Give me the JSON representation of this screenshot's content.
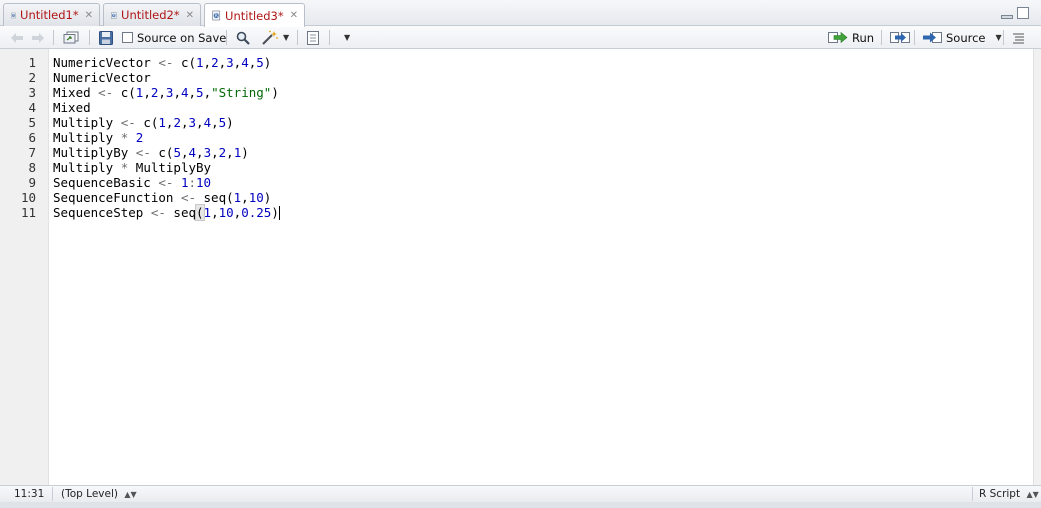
{
  "tabs": [
    {
      "label": "Untitled1*",
      "active": false
    },
    {
      "label": "Untitled2*",
      "active": false
    },
    {
      "label": "Untitled3*",
      "active": true
    }
  ],
  "toolbar": {
    "source_on_save_label": "Source on Save",
    "run_label": "Run",
    "source_label": "Source"
  },
  "editor": {
    "lines": [
      {
        "n": "1",
        "tokens": [
          [
            "id",
            "NumericVector "
          ],
          [
            "op",
            "<-"
          ],
          [
            "id",
            " c("
          ],
          [
            "num",
            "1"
          ],
          [
            "id",
            ","
          ],
          [
            "num",
            "2"
          ],
          [
            "id",
            ","
          ],
          [
            "num",
            "3"
          ],
          [
            "id",
            ","
          ],
          [
            "num",
            "4"
          ],
          [
            "id",
            ","
          ],
          [
            "num",
            "5"
          ],
          [
            "id",
            ")"
          ]
        ]
      },
      {
        "n": "2",
        "tokens": [
          [
            "id",
            "NumericVector"
          ]
        ]
      },
      {
        "n": "3",
        "tokens": [
          [
            "id",
            "Mixed "
          ],
          [
            "op",
            "<-"
          ],
          [
            "id",
            " c("
          ],
          [
            "num",
            "1"
          ],
          [
            "id",
            ","
          ],
          [
            "num",
            "2"
          ],
          [
            "id",
            ","
          ],
          [
            "num",
            "3"
          ],
          [
            "id",
            ","
          ],
          [
            "num",
            "4"
          ],
          [
            "id",
            ","
          ],
          [
            "num",
            "5"
          ],
          [
            "id",
            ","
          ],
          [
            "str",
            "\"String\""
          ],
          [
            "id",
            ")"
          ]
        ]
      },
      {
        "n": "4",
        "tokens": [
          [
            "id",
            "Mixed"
          ]
        ]
      },
      {
        "n": "5",
        "tokens": [
          [
            "id",
            "Multiply "
          ],
          [
            "op",
            "<-"
          ],
          [
            "id",
            " c("
          ],
          [
            "num",
            "1"
          ],
          [
            "id",
            ","
          ],
          [
            "num",
            "2"
          ],
          [
            "id",
            ","
          ],
          [
            "num",
            "3"
          ],
          [
            "id",
            ","
          ],
          [
            "num",
            "4"
          ],
          [
            "id",
            ","
          ],
          [
            "num",
            "5"
          ],
          [
            "id",
            ")"
          ]
        ]
      },
      {
        "n": "6",
        "tokens": [
          [
            "id",
            "Multiply "
          ],
          [
            "op",
            "*"
          ],
          [
            "id",
            " "
          ],
          [
            "num",
            "2"
          ]
        ]
      },
      {
        "n": "7",
        "tokens": [
          [
            "id",
            "MultiplyBy "
          ],
          [
            "op",
            "<-"
          ],
          [
            "id",
            " c("
          ],
          [
            "num",
            "5"
          ],
          [
            "id",
            ","
          ],
          [
            "num",
            "4"
          ],
          [
            "id",
            ","
          ],
          [
            "num",
            "3"
          ],
          [
            "id",
            ","
          ],
          [
            "num",
            "2"
          ],
          [
            "id",
            ","
          ],
          [
            "num",
            "1"
          ],
          [
            "id",
            ")"
          ]
        ]
      },
      {
        "n": "8",
        "tokens": [
          [
            "id",
            "Multiply "
          ],
          [
            "op",
            "*"
          ],
          [
            "id",
            " MultiplyBy"
          ]
        ]
      },
      {
        "n": "9",
        "tokens": [
          [
            "id",
            "SequenceBasic "
          ],
          [
            "op",
            "<-"
          ],
          [
            "id",
            " "
          ],
          [
            "num",
            "1"
          ],
          [
            "op",
            ":"
          ],
          [
            "num",
            "10"
          ]
        ]
      },
      {
        "n": "10",
        "tokens": [
          [
            "id",
            "SequenceFunction "
          ],
          [
            "op",
            "<-"
          ],
          [
            "id",
            " seq("
          ],
          [
            "num",
            "1"
          ],
          [
            "id",
            ","
          ],
          [
            "num",
            "10"
          ],
          [
            "id",
            ")"
          ]
        ]
      },
      {
        "n": "11",
        "tokens": [
          [
            "id",
            "SequenceStep "
          ],
          [
            "op",
            "<-"
          ],
          [
            "id",
            " seq"
          ],
          [
            "bracket",
            "("
          ],
          [
            "num",
            "1"
          ],
          [
            "id",
            ","
          ],
          [
            "num",
            "10"
          ],
          [
            "id",
            ","
          ],
          [
            "num",
            "0.25"
          ],
          [
            "id",
            ")"
          ],
          [
            "cursor",
            ""
          ]
        ]
      }
    ]
  },
  "status": {
    "position": "11:31",
    "scope": "(Top Level)",
    "filetype": "R Script"
  },
  "colors": {
    "tab_label": "#b01515",
    "number": "#0000c0",
    "string": "#036a07",
    "operator": "#6e6e6e"
  },
  "icons": [
    "r-file-icon",
    "close-icon",
    "back-arrow-icon",
    "forward-arrow-icon",
    "show-in-window-icon",
    "save-icon",
    "checkbox",
    "search-icon",
    "magic-wand-icon",
    "compile-notebook-icon",
    "more-options-icon",
    "run-icon",
    "rerun-icon",
    "source-icon",
    "outline-icon",
    "minimize-icon",
    "maximize-icon"
  ]
}
